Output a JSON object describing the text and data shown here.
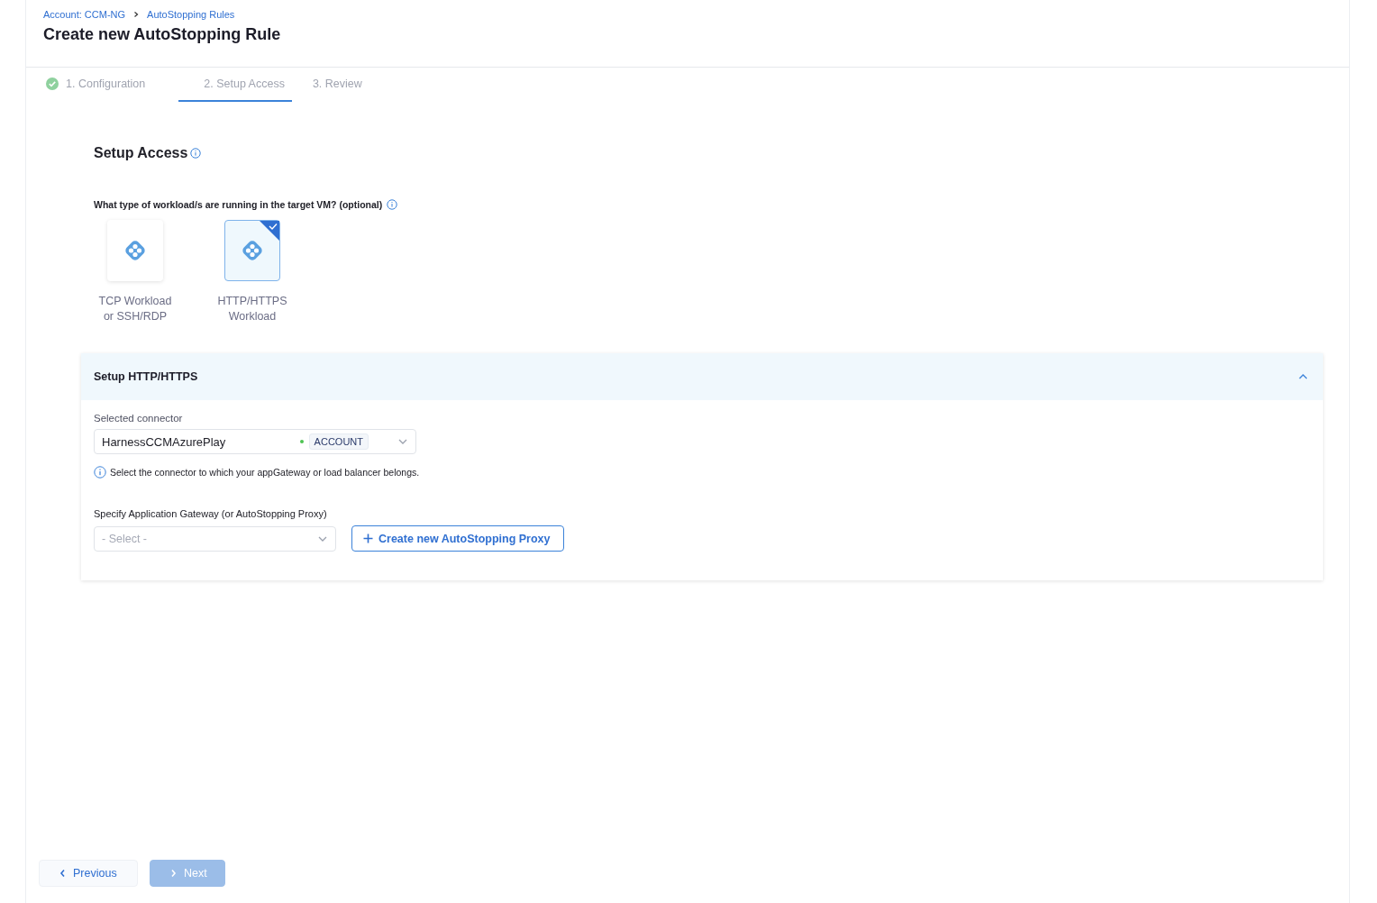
{
  "breadcrumbs": [
    "Account: CCM-NG",
    "AutoStopping Rules"
  ],
  "title": "Create new AutoStopping Rule",
  "steps": [
    {
      "label": "1. Configuration",
      "selected": false,
      "completed": true
    },
    {
      "label": "2. Setup Access",
      "selected": true,
      "completed": false
    },
    {
      "label": "3. Review",
      "selected": false,
      "completed": false
    }
  ],
  "section_title": "Setup Access",
  "question": "What type of workload/s are running in the target VM? (optional)",
  "workloads": [
    {
      "label": "TCP Workload or SSH/RDP",
      "selected": false
    },
    {
      "label": "HTTP/HTTPS Workload",
      "selected": true
    }
  ],
  "panel": {
    "title": "Setup HTTP/HTTPS",
    "expanded": true,
    "connector_label": "Selected connector",
    "connector_value": "HarnessCCMAzurePlay",
    "connector_scope": "ACCOUNT",
    "help_text": "Select the connector to which your appGateway or load balancer belongs.",
    "gateway_label": "Specify Application Gateway (or AutoStopping Proxy)",
    "gateway_placeholder": "- Select -",
    "create_button": "Create new AutoStopping Proxy"
  },
  "footer": {
    "previous": {
      "label": "Previous",
      "disabled": false
    },
    "next": {
      "label": "Next",
      "disabled": true
    }
  }
}
